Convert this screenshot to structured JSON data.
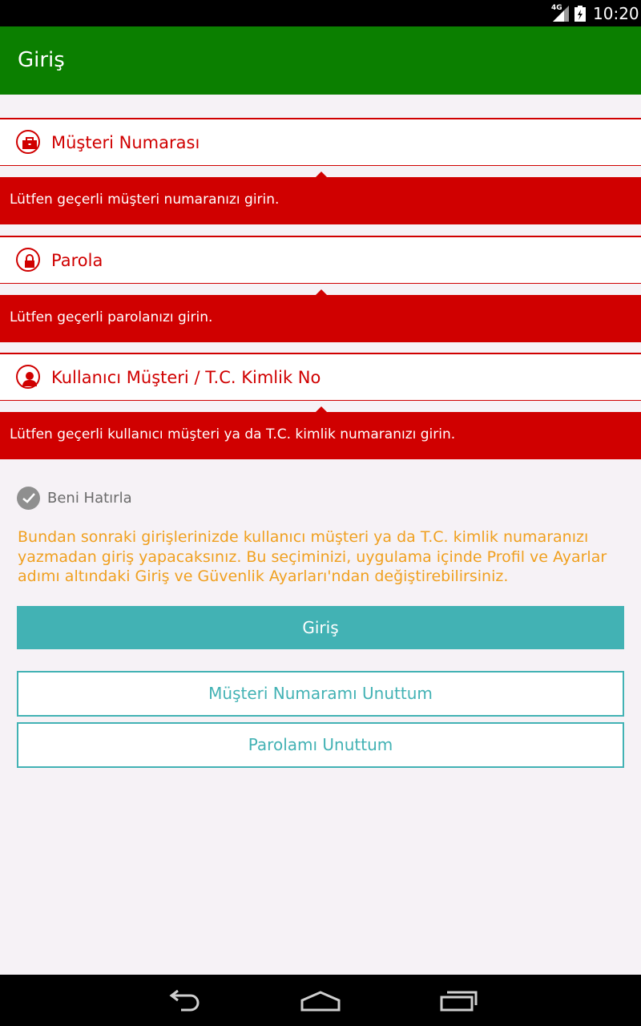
{
  "status_bar": {
    "network": "4G",
    "time": "10:20"
  },
  "app_bar": {
    "title": "Giriş"
  },
  "fields": {
    "customer_number": {
      "label": "Müşteri Numarası",
      "error": "Lütfen geçerli müşteri numaranızı girin."
    },
    "password": {
      "label": "Parola",
      "error": "Lütfen geçerli parolanızı girin."
    },
    "user_id": {
      "label": "Kullanıcı Müşteri / T.C. Kimlik No",
      "error": "Lütfen geçerli kullanıcı müşteri ya da T.C. kimlik numaranızı girin."
    }
  },
  "remember": {
    "label": "Beni Hatırla",
    "checked": true
  },
  "info_text": "Bundan sonraki girişlerinizde kullanıcı müşteri ya da T.C. kimlik numaranızı yazmadan giriş yapacaksınız. Bu seçiminizi, uygulama içinde Profil ve Ayarlar adımı altındaki Giriş ve Güvenlik Ayarları'ndan değiştirebilirsiniz.",
  "buttons": {
    "login": "Giriş",
    "forgot_customer_number": "Müşteri Numaramı Unuttum",
    "forgot_password": "Parolamı Unuttum"
  },
  "colors": {
    "app_bar": "#0b7f00",
    "error": "#d00000",
    "accent": "#42b2b4",
    "info": "#f0a020"
  },
  "icons": {
    "customer_number": "briefcase-icon",
    "password": "lock-icon",
    "user_id": "person-icon",
    "remember": "checkmark-icon"
  }
}
